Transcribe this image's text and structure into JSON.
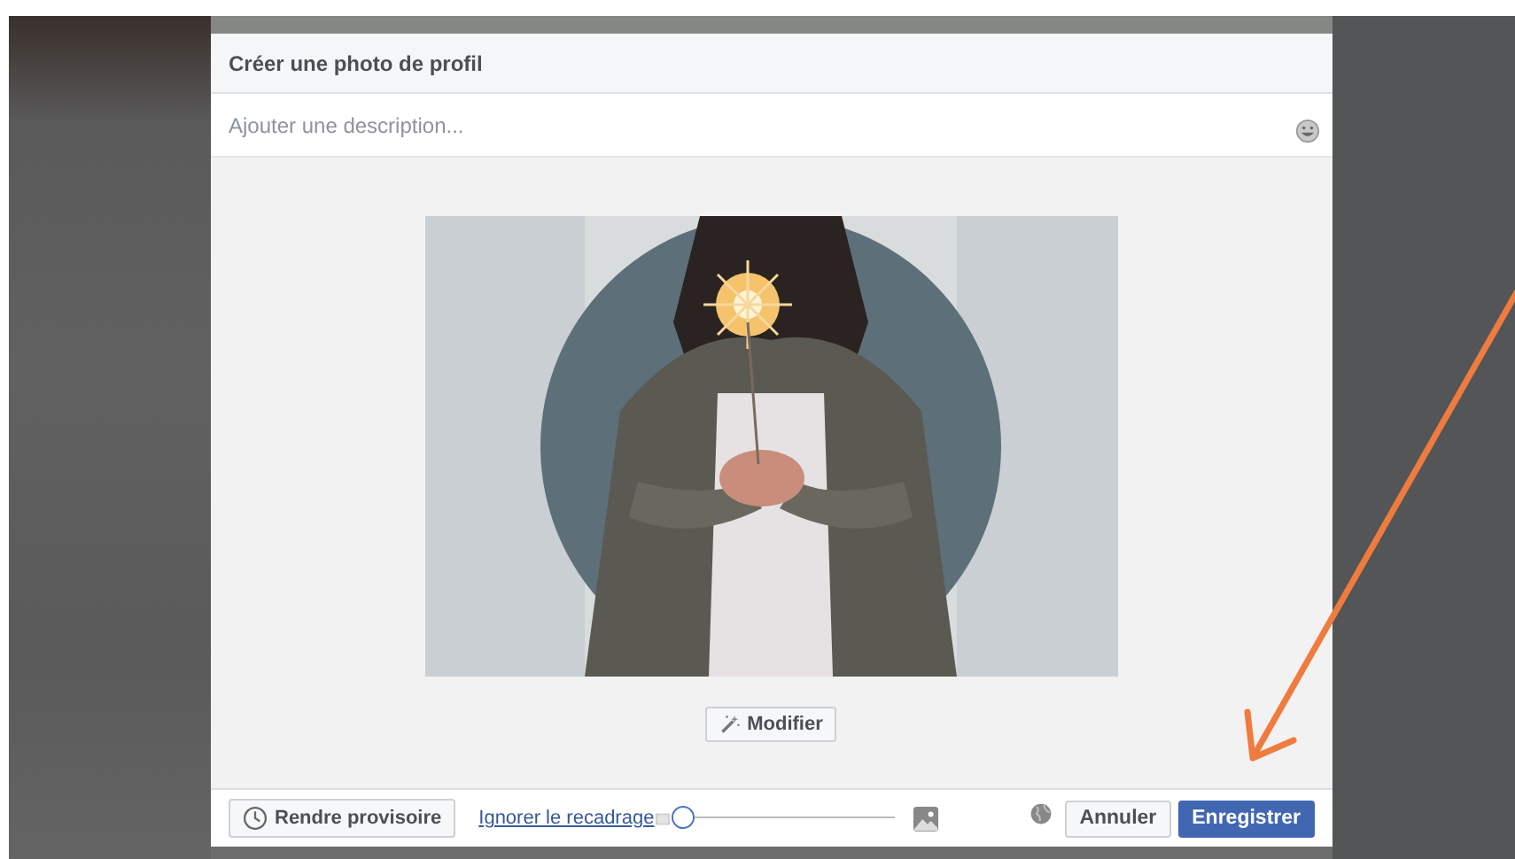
{
  "dialog": {
    "title": "Créer une photo de profil",
    "description": {
      "placeholder": "Ajouter une description..."
    },
    "edit_button": "Modifier",
    "footer": {
      "temporary_button": "Rendre provisoire",
      "skip_crop_link": "Ignorer le recadrage",
      "zoom": {
        "level": 0
      },
      "cancel_button": "Annuler",
      "save_button": "Enregistrer"
    }
  }
}
